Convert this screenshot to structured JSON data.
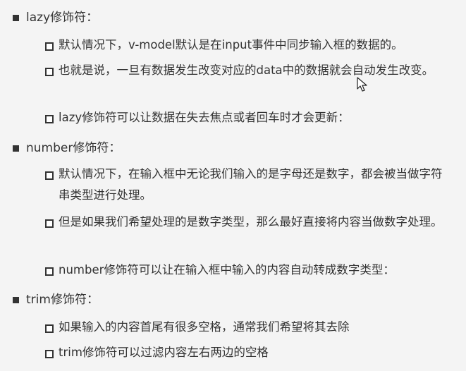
{
  "sections": [
    {
      "title": "lazy修饰符：",
      "items": [
        "默认情况下，v-model默认是在input事件中同步输入框的数据的。",
        "也就是说，一旦有数据发生改变对应的data中的数据就会自动发生改变。",
        "lazy修饰符可以让数据在失去焦点或者回车时才会更新："
      ]
    },
    {
      "title": "number修饰符：",
      "items": [
        "默认情况下，在输入框中无论我们输入的是字母还是数字，都会被当做字符串类型进行处理。",
        "但是如果我们希望处理的是数字类型，那么最好直接将内容当做数字处理。",
        "number修饰符可以让在输入框中输入的内容自动转成数字类型："
      ]
    },
    {
      "title": "trim修饰符：",
      "items": [
        "如果输入的内容首尾有很多空格，通常我们希望将其去除",
        "trim修饰符可以过滤内容左右两边的空格"
      ]
    }
  ],
  "cursor_icon": "mouse-pointer-icon"
}
